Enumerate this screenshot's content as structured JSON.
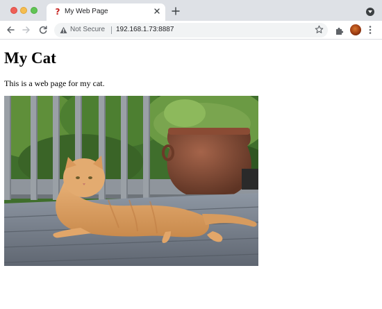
{
  "tab": {
    "title": "My Web Page",
    "favicon": "?"
  },
  "address_bar": {
    "security_label": "Not Secure",
    "url": "192.168.1.73:8887"
  },
  "page": {
    "heading": "My Cat",
    "paragraph": "This is a web page for my cat."
  },
  "colors": {
    "tabstrip": "#dee1e6",
    "close": "#ee5f57",
    "minimize": "#f5bd4f",
    "maximize": "#61c454"
  }
}
